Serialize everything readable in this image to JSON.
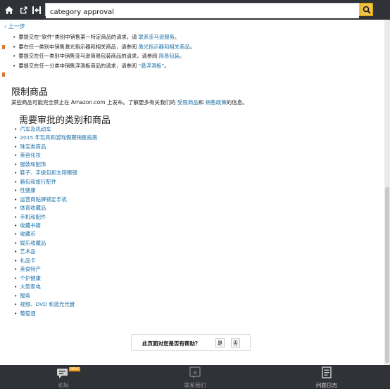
{
  "toolbar": {
    "home_icon": "home-icon",
    "external_icon": "external-link-icon",
    "panel_icon": "panel-toggle-icon",
    "search_value": "category approval",
    "search_icon": "search-icon"
  },
  "page": {
    "back": "‹ 上一步",
    "tips": [
      {
        "prefix": "要提交在“软件”类别中销售某一特定商品的请求，请 ",
        "link": "联系亚马逊服务",
        "suffix": "。"
      },
      {
        "prefix": "要在任一类别中销售激光指示器和相关商品，请参阅 ",
        "link": "激光指示器和相关商品",
        "suffix": "。"
      },
      {
        "prefix": "要提交在任一类别中销售亚马逊简易包装商品的请求，请参阅 ",
        "link": "简易包装",
        "suffix": "。"
      },
      {
        "prefix": "要提交在任一分类中销售浮滑板商品的请求，请参阅 ",
        "link": "“悬浮滑板”",
        "suffix": "。"
      }
    ],
    "restricted_heading": "限制商品",
    "restricted_text_1": "某些商品可能完全禁止在 Amazon.com 上发布。了解更多有关我们的 ",
    "restricted_link_1": "受限商品",
    "restricted_text_2": "和 ",
    "restricted_link_2": "销售政策",
    "restricted_text_3": "的信息。",
    "approval_heading": "需要审批的类别和商品",
    "categories": [
      "汽车及机动车",
      "2015 年玩具和游戏假期销售指南",
      "珠宝类商品",
      "美容化妆",
      "服装和配饰",
      "鞋子、手提包和太阳眼镜",
      "箱包和旅行配件",
      "性健康",
      "运营商贴牌锁定手机",
      "体育收藏品",
      "手机和配件",
      "收藏书籍",
      "收藏币",
      "娱乐收藏品",
      "艺术品",
      "礼品卡",
      "美食特产",
      "个护健康",
      "大型家电",
      "服务",
      "视频、DVD 和蓝光光盘",
      "葡萄酒"
    ],
    "helpful_question": "此页面对您是否有帮助？",
    "yes": "是",
    "no": "否"
  },
  "bottom_nav": {
    "forum": "论坛",
    "forum_badge": "NEW",
    "contact": "联系我们",
    "logs": "问题日志"
  }
}
